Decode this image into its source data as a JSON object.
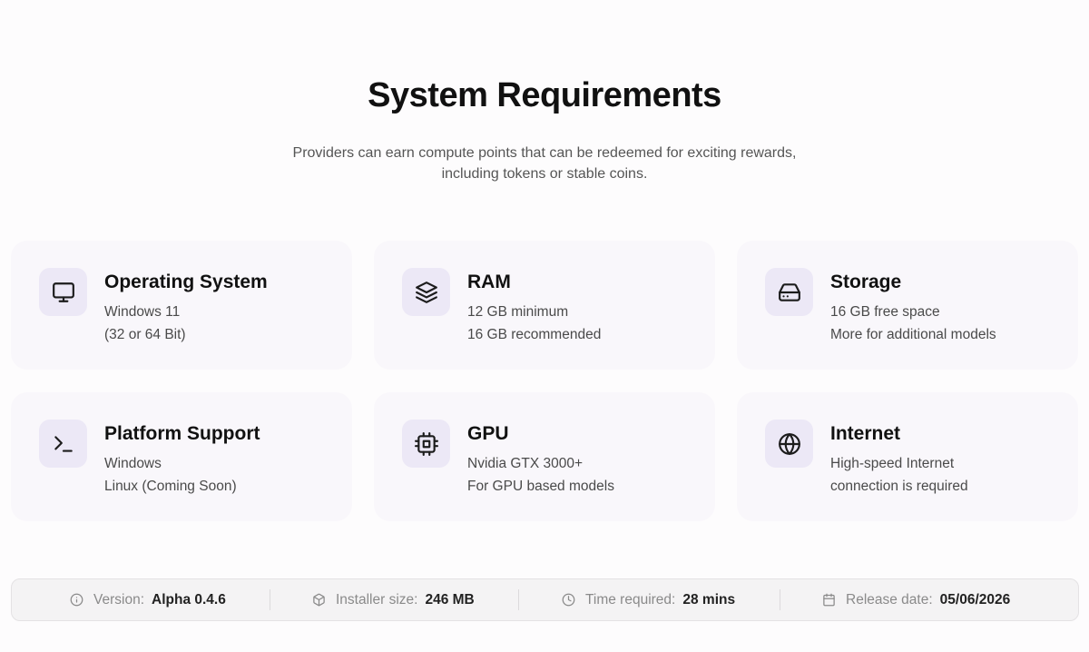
{
  "header": {
    "title": "System Requirements",
    "subtitle_line1": "Providers can earn compute points that can be redeemed for exciting rewards,",
    "subtitle_line2": "including tokens or stable coins."
  },
  "requirements": [
    {
      "icon": "monitor-icon",
      "title": "Operating System",
      "line1": "Windows 11",
      "line2": "(32 or 64 Bit)"
    },
    {
      "icon": "layers-icon",
      "title": "RAM",
      "line1": "12 GB minimum",
      "line2": "16 GB recommended"
    },
    {
      "icon": "hard-drive-icon",
      "title": "Storage",
      "line1": "16 GB free space",
      "line2": "More for additional models"
    },
    {
      "icon": "terminal-icon",
      "title": "Platform Support",
      "line1": "Windows",
      "line2": "Linux (Coming Soon)"
    },
    {
      "icon": "cpu-chip-icon",
      "title": "GPU",
      "line1": "Nvidia GTX 3000+",
      "line2": "For GPU based models"
    },
    {
      "icon": "globe-icon",
      "title": "Internet",
      "line1": "High-speed Internet",
      "line2": "connection is required"
    }
  ],
  "info_bar": [
    {
      "icon": "info-icon",
      "label": "Version:",
      "value": "Alpha 0.4.6"
    },
    {
      "icon": "package-icon",
      "label": "Installer size:",
      "value": "246 MB"
    },
    {
      "icon": "clock-icon",
      "label": "Time required:",
      "value": "28 mins"
    },
    {
      "icon": "calendar-icon",
      "label": "Release date:",
      "value": "05/06/2026"
    }
  ],
  "colors": {
    "background": "#fdfcfd",
    "card_background": "#f9f7fb",
    "icon_tile": "#ece8f6",
    "info_bar_background": "#f4f3f4"
  }
}
